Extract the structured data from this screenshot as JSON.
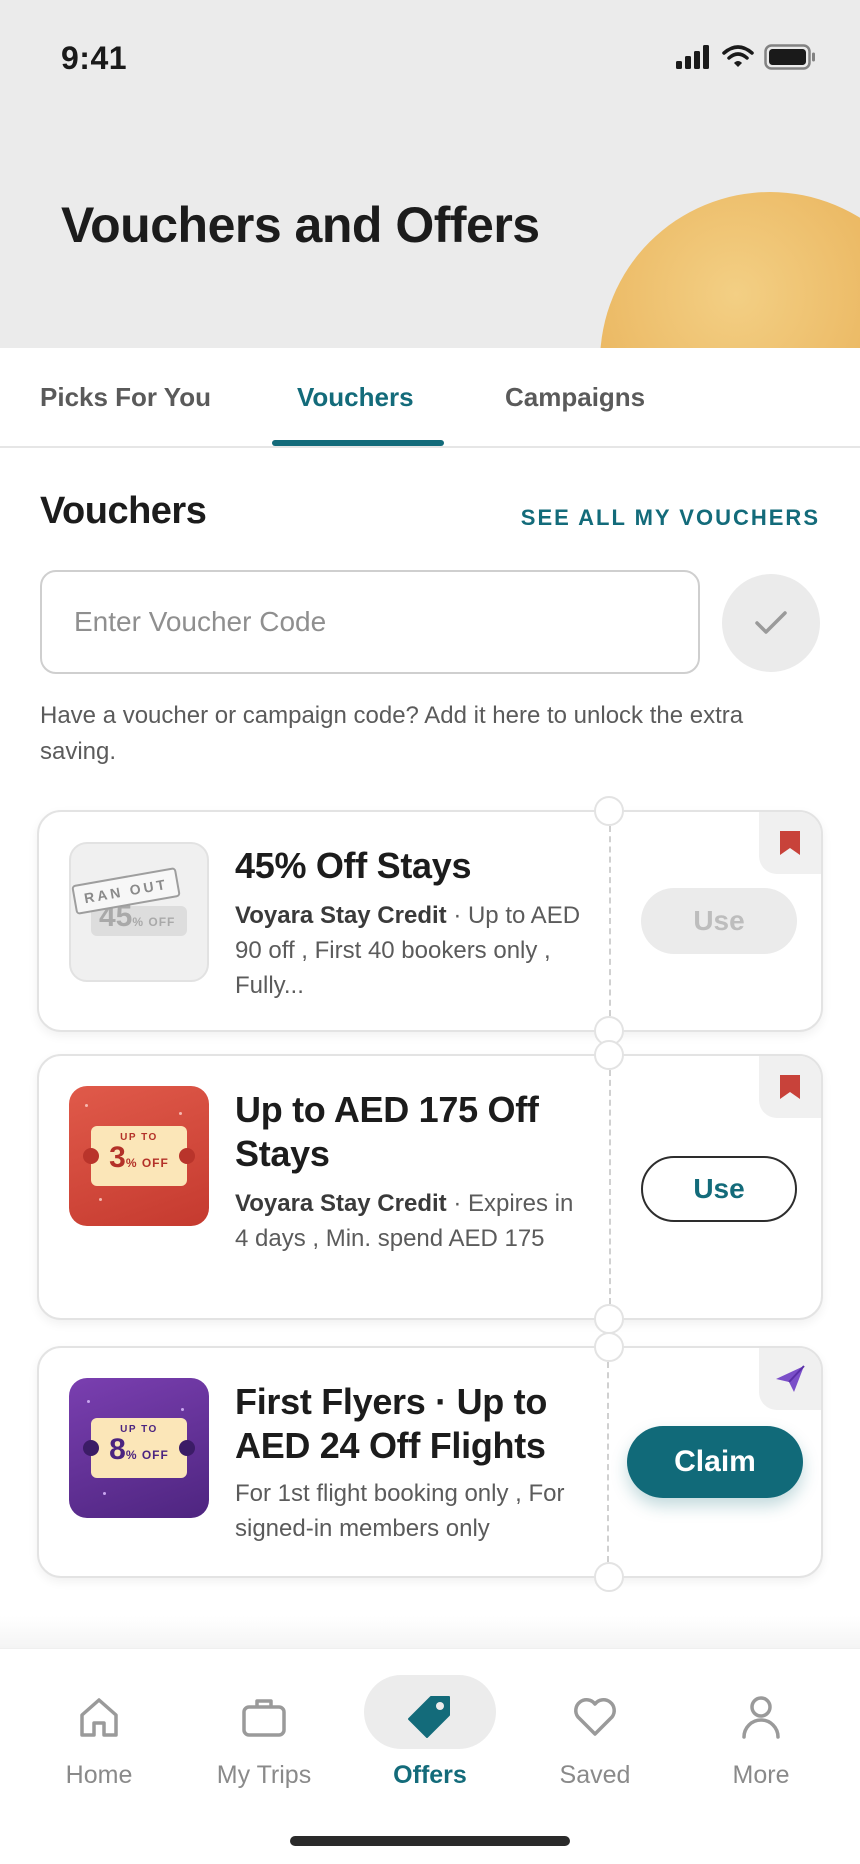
{
  "status_bar": {
    "time": "9:41"
  },
  "header": {
    "title": "Vouchers and Offers"
  },
  "tabs": [
    {
      "label": "Picks For You",
      "active": false
    },
    {
      "label": "Vouchers",
      "active": true
    },
    {
      "label": "Campaigns",
      "active": false
    }
  ],
  "section": {
    "title": "Vouchers",
    "see_all": "SEE ALL MY VOUCHERS"
  },
  "voucher_input": {
    "placeholder": "Enter Voucher Code",
    "value": ""
  },
  "helper_text": "Have a voucher or campaign code? Add it here to unlock the extra saving.",
  "vouchers": [
    {
      "title": "45% Off Stays",
      "source": "Voyara Stay Credit",
      "details": "· Up to AED 90 off , First 40 bookers only , Fully...",
      "thumb_badge": "RAN OUT",
      "thumb_value": "45",
      "thumb_unit": "% OFF",
      "corner_icon": "bookmark-icon",
      "action": "Use",
      "action_state": "disabled"
    },
    {
      "title": "Up to AED 175 Off Stays",
      "source": "Voyara Stay Credit",
      "details": "· Expires in 4 days , Min. spend AED 175",
      "thumb_badge": "UP TO",
      "thumb_value": "3",
      "thumb_unit": "% OFF",
      "corner_icon": "bookmark-icon",
      "action": "Use",
      "action_state": "enabled"
    },
    {
      "title": "First Flyers · Up to AED 24 Off Flights",
      "source": "",
      "details": "For 1st flight booking only , For signed-in members only",
      "thumb_badge": "UP TO",
      "thumb_value": "8",
      "thumb_unit": "% OFF",
      "corner_icon": "plane-icon",
      "action": "Claim",
      "action_state": "primary"
    }
  ],
  "bottom_nav": [
    {
      "label": "Home",
      "icon": "home-icon",
      "active": false
    },
    {
      "label": "My Trips",
      "icon": "briefcase-icon",
      "active": false
    },
    {
      "label": "Offers",
      "icon": "tag-icon",
      "active": true
    },
    {
      "label": "Saved",
      "icon": "heart-icon",
      "active": false
    },
    {
      "label": "More",
      "icon": "person-icon",
      "active": false
    }
  ],
  "colors": {
    "accent": "#136b7a",
    "header_bg": "#ebebeb",
    "sun": "#eab55e",
    "bookmark": "#c8423a",
    "plane": "#7b4fc9",
    "voucher_red": "#d2483c",
    "voucher_purple": "#5b2d8e"
  }
}
